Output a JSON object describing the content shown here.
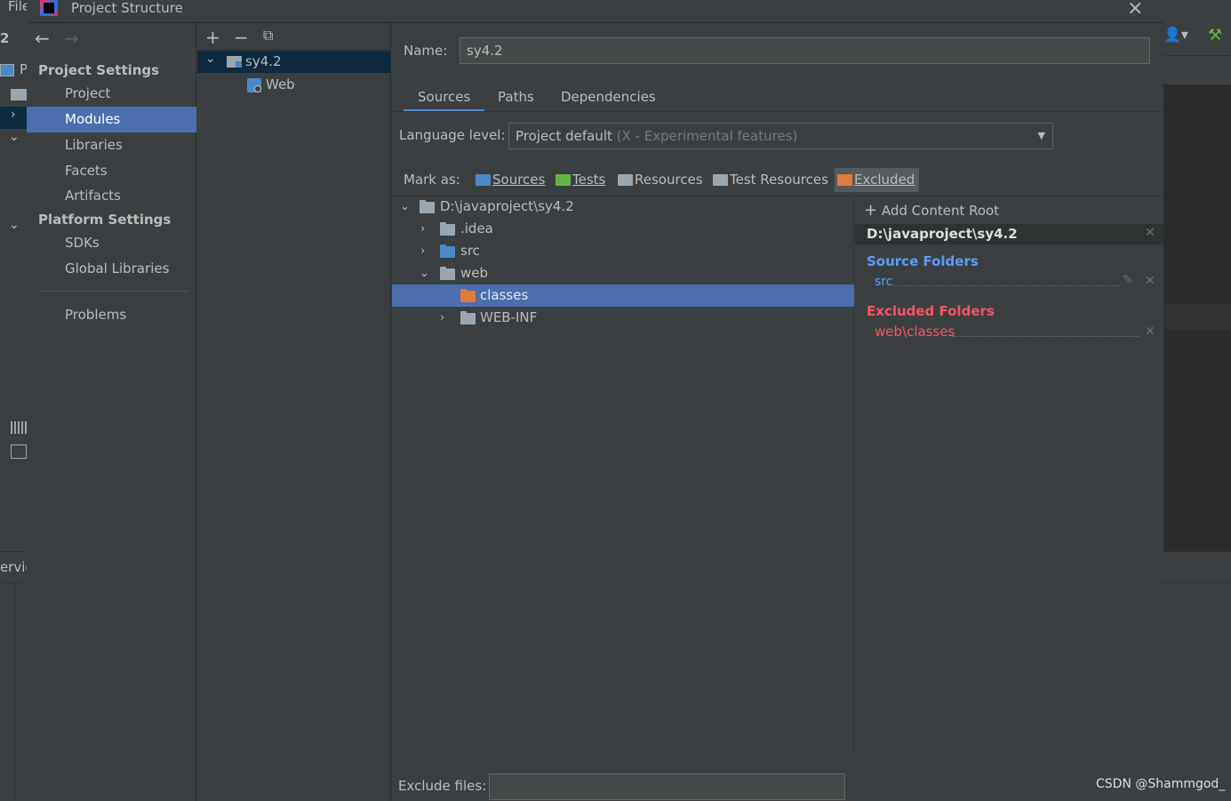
{
  "ide": {
    "menu_file": "File",
    "left_num": "2",
    "left_p": "P",
    "service_label": "ervic"
  },
  "dialog": {
    "title": "Project Structure"
  },
  "nav": {
    "project_settings": "Project Settings",
    "platform_settings": "Platform Settings",
    "items": [
      {
        "label": "Project"
      },
      {
        "label": "Modules"
      },
      {
        "label": "Libraries"
      },
      {
        "label": "Facets"
      },
      {
        "label": "Artifacts"
      },
      {
        "label": "SDKs"
      },
      {
        "label": "Global Libraries"
      },
      {
        "label": "Problems"
      }
    ]
  },
  "modules": {
    "root": "sy4.2",
    "child": "Web"
  },
  "main": {
    "name_label": "Name:",
    "name_value": "sy4.2",
    "tabs": [
      "Sources",
      "Paths",
      "Dependencies"
    ],
    "language_label": "Language level:",
    "language_value": "Project default",
    "language_hint": "(X - Experimental features)",
    "mark_as": "Mark as:",
    "mark_buttons": [
      {
        "label": "Sources",
        "color": "#4a88c7"
      },
      {
        "label": "Tests",
        "color": "#62b543"
      },
      {
        "label": "Resources",
        "color": "#9aa7b0"
      },
      {
        "label": "Test Resources",
        "color": "#9aa7b0"
      },
      {
        "label": "Excluded",
        "color": "#e07b39"
      }
    ],
    "tree": {
      "root": "D:\\javaproject\\sy4.2",
      "idea": ".idea",
      "src": "src",
      "web": "web",
      "classes": "classes",
      "webinf": "WEB-INF"
    },
    "exclude_label": "Exclude files:",
    "exclude_value": ""
  },
  "roots": {
    "add_label": "Add Content Root",
    "root_path": "D:\\javaproject\\sy4.2",
    "source_title": "Source Folders",
    "source_item": "src",
    "excluded_title": "Excluded Folders",
    "excluded_item": "web\\classes",
    "source_color": "#589df6",
    "excluded_color": "#f75464"
  },
  "watermark": "CSDN @Shammgod_"
}
